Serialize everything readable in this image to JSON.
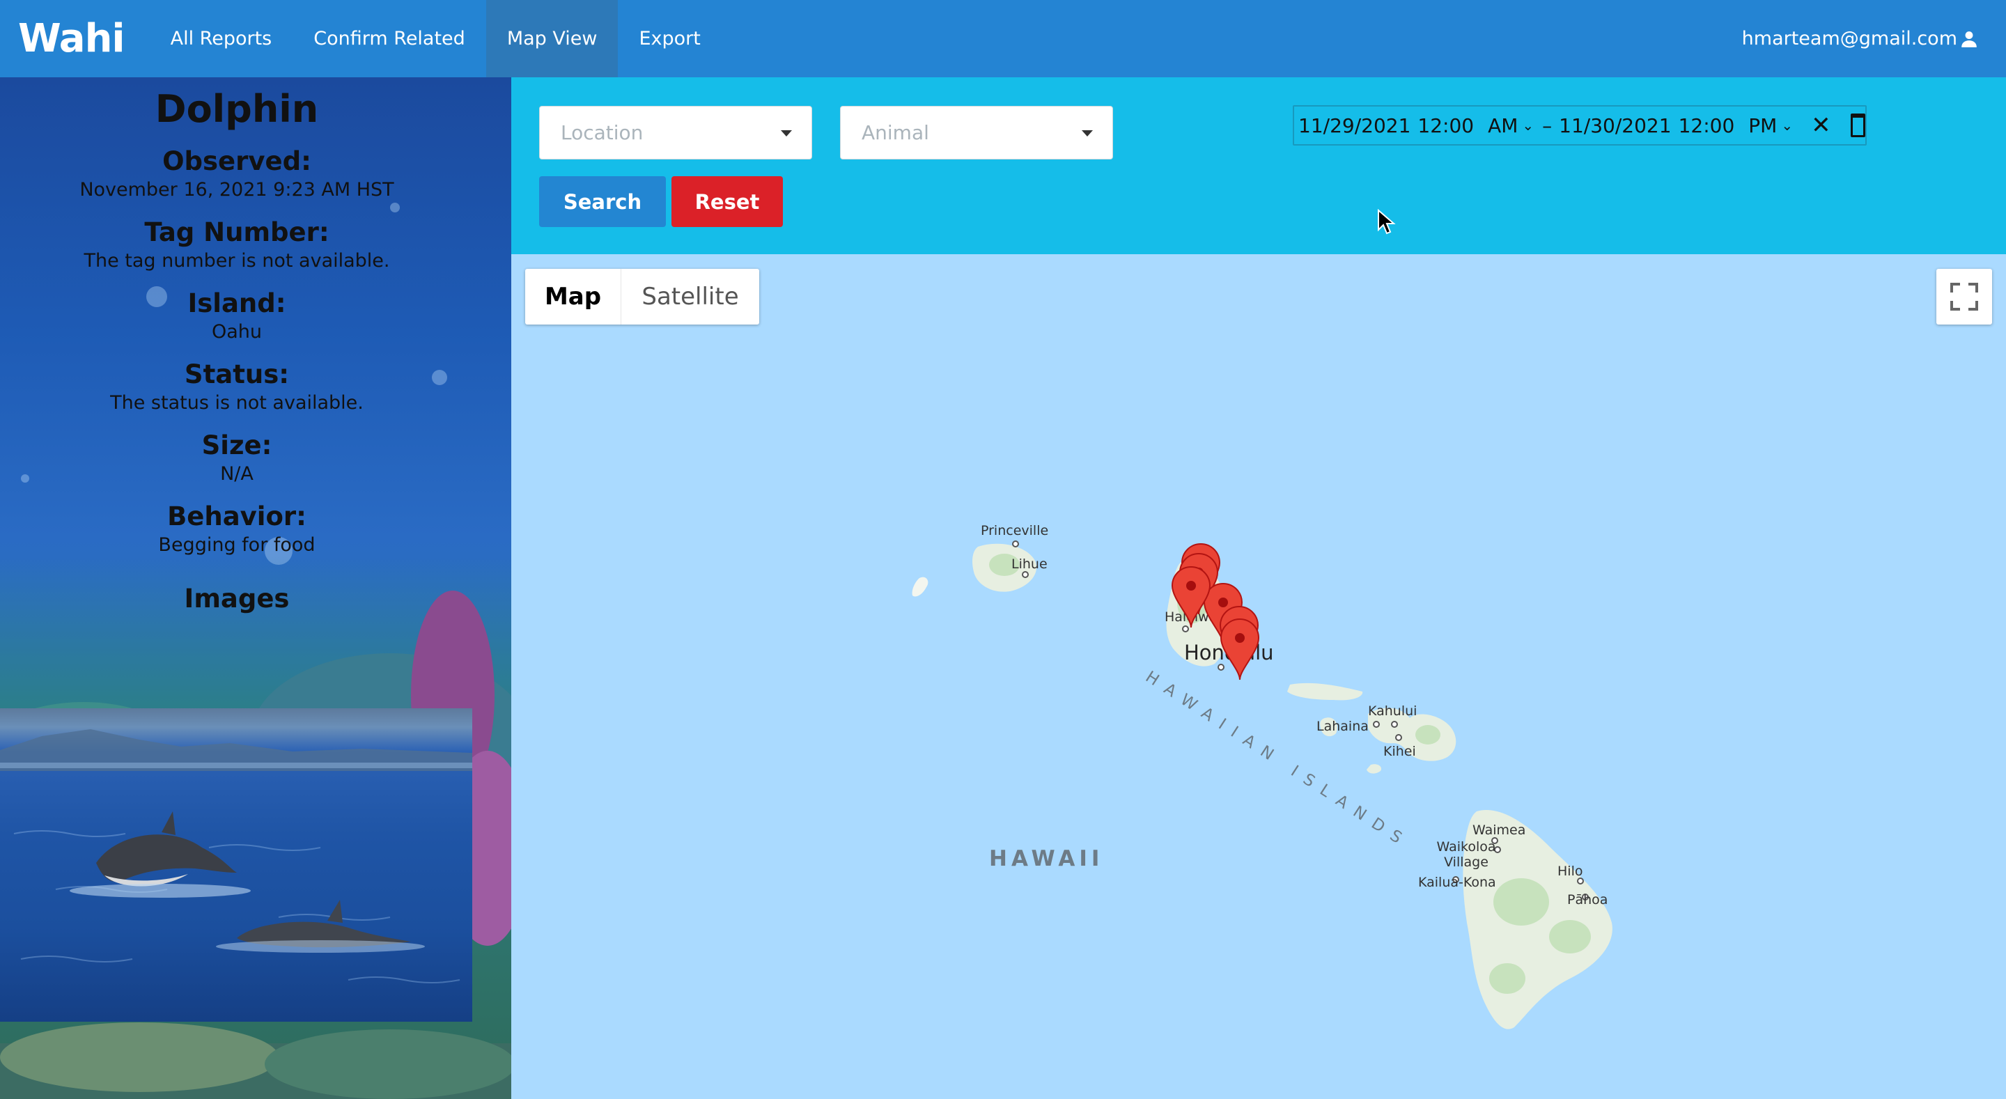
{
  "nav": {
    "brand": "Wahi",
    "items": [
      "All Reports",
      "Confirm Related",
      "Map View",
      "Export"
    ],
    "active_item": "Map View",
    "user_email": "hmarteam@gmail.com"
  },
  "sidebar": {
    "animal": "Dolphin",
    "fields": [
      {
        "label": "Observed:",
        "value": "November 16, 2021 9:23 AM HST"
      },
      {
        "label": "Tag Number:",
        "value": "The tag number is not available."
      },
      {
        "label": "Island:",
        "value": "Oahu"
      },
      {
        "label": "Status:",
        "value": "The status is not available."
      },
      {
        "label": "Size:",
        "value": "N/A"
      },
      {
        "label": "Behavior:",
        "value": "Begging for food"
      }
    ],
    "images_title": "Images"
  },
  "filters": {
    "location_placeholder": "Location",
    "animal_placeholder": "Animal",
    "search_label": "Search",
    "reset_label": "Reset",
    "date_range": {
      "start_date": "11/29/2021",
      "start_time": "12:00",
      "start_ampm": "AM",
      "separator": "–",
      "end_date": "11/30/2021",
      "end_time": "12:00",
      "end_ampm": "PM"
    }
  },
  "map": {
    "map_type_options": [
      "Map",
      "Satellite"
    ],
    "selected_map_type": "Map",
    "region_label": "HAWAII",
    "chain_label": "HAWAIIAN ISLANDS",
    "place_labels": [
      "Princeville",
      "Lihue",
      "Haleiwa",
      "Honolulu",
      "Kahului",
      "Lahaina",
      "Kihei",
      "Waimea",
      "Waikoloa Village",
      "Kailua-Kona",
      "Hilo",
      "Pāhoa"
    ],
    "marker_count": 6,
    "colors": {
      "water": "#aadaff",
      "land": "#e8f1e0",
      "marker": "#ea4335"
    }
  }
}
